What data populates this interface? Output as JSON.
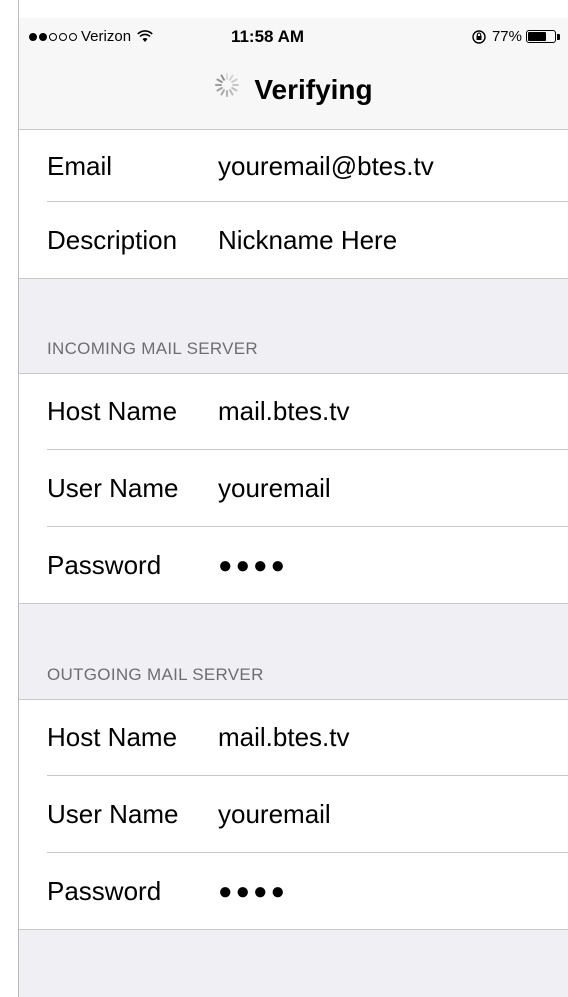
{
  "status_bar": {
    "carrier": "Verizon",
    "time": "11:58 AM",
    "battery": "77%",
    "battery_level": 0.77,
    "signal_bars_filled": 2,
    "signal_bars_total": 5
  },
  "nav": {
    "title": "Verifying",
    "spinner_icon": "activity-spinner-icon"
  },
  "account": {
    "email_label": "Email",
    "email_value": "youremail@btes.tv",
    "description_label": "Description",
    "description_value": "Nickname Here"
  },
  "incoming": {
    "header": "INCOMING MAIL SERVER",
    "host_label": "Host Name",
    "host_value": "mail.btes.tv",
    "user_label": "User Name",
    "user_value": "youremail",
    "password_label": "Password",
    "password_value": "●●●●"
  },
  "outgoing": {
    "header": "OUTGOING MAIL SERVER",
    "host_label": "Host Name",
    "host_value": "mail.btes.tv",
    "user_label": "User Name",
    "user_value": "youremail",
    "password_label": "Password",
    "password_value": "●●●●"
  }
}
